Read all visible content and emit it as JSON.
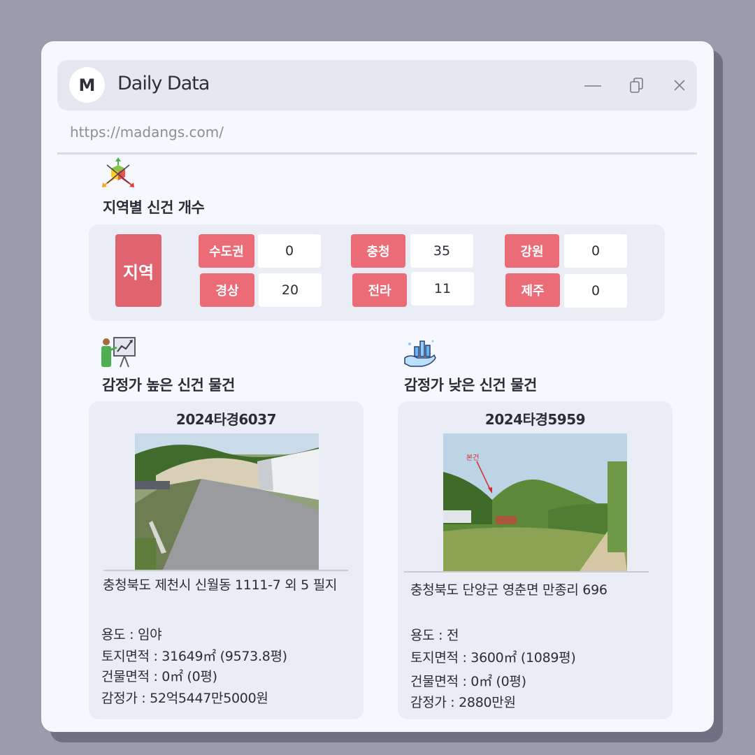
{
  "window": {
    "title": "Daily Data",
    "logo_letter": "M",
    "url": "https://madangs.com/"
  },
  "region_section": {
    "title": "지역별 신건 개수",
    "big_label": "지역",
    "regions": [
      {
        "label": "수도권",
        "value": "0"
      },
      {
        "label": "충청",
        "value": "35"
      },
      {
        "label": "강원",
        "value": "0"
      },
      {
        "label": "경상",
        "value": "20"
      },
      {
        "label": "전라",
        "value": "11"
      },
      {
        "label": "제주",
        "value": "0"
      }
    ]
  },
  "high_section": {
    "title": "감정가 높은 신건 물건",
    "case_no": "2024타경6037",
    "address": "충청북도 제천시 신월동 1111-7 외 5 필지",
    "usage": "용도 : 임야",
    "land_area": "토지면적 : 31649㎡ (9573.8평)",
    "building_area": "건물면적 : 0㎡ (0평)",
    "appraisal": "감정가 : 52억5447만5000원"
  },
  "low_section": {
    "title": "감정가 낮은 신건 물건",
    "case_no": "2024타경5959",
    "photo_annotation": "본건",
    "address": "충청북도 단양군 영춘면 만종리 696",
    "usage": "용도 : 전",
    "land_area": "토지면적 : 3600㎡ (1089평)",
    "building_area": "건물면적 : 0㎡ (0평)",
    "appraisal": "감정가 : 2880만원"
  },
  "colors": {
    "accent_red": "#eb6b77",
    "region_big": "#e06470",
    "panel": "#ebedf6",
    "background": "#9a9cae"
  },
  "icons": [
    "axis-cube-icon",
    "presentation-chart-icon",
    "hand-chart-icon",
    "minimize-icon",
    "restore-icon",
    "close-icon"
  ]
}
